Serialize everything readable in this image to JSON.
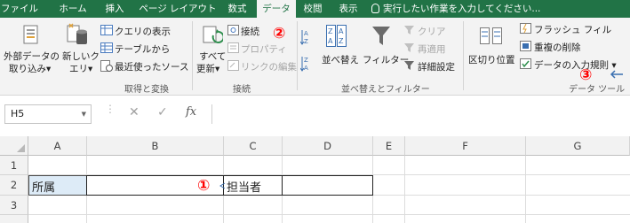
{
  "tabs": [
    {
      "label": "ファイル",
      "active": false
    },
    {
      "label": "ホーム",
      "active": false
    },
    {
      "label": "挿入",
      "active": false
    },
    {
      "label": "ページ レイアウト",
      "active": false
    },
    {
      "label": "数式",
      "active": false
    },
    {
      "label": "データ",
      "active": true
    },
    {
      "label": "校閲",
      "active": false
    },
    {
      "label": "表示",
      "active": false
    }
  ],
  "tell_me": "実行したい作業を入力してください...",
  "groups": {
    "get_transform": {
      "label": "取得と変換",
      "external_data": [
        "外部データの",
        "取り込み▾"
      ],
      "new_query": [
        "新しいク",
        "エリ▾"
      ],
      "show_queries": "クエリの表示",
      "from_table": "テーブルから",
      "recent_sources": "最近使ったソース"
    },
    "connections": {
      "label": "接続",
      "refresh_all": [
        "すべて",
        "更新▾"
      ],
      "connections_btn": "接続",
      "properties": "プロパティ",
      "edit_links": "リンクの編集"
    },
    "sort_filter": {
      "label": "並べ替えとフィルター",
      "sort_btn": "並べ替え",
      "filter_btn": "フィルター",
      "clear": "クリア",
      "reapply": "再適用",
      "advanced": "詳細設定"
    },
    "data_tools": {
      "label": "データ ツール",
      "text_to_columns": "区切り位置",
      "flash_fill": "フラッシュ フィル",
      "remove_duplicates": "重複の削除",
      "data_validation": "データの入力規則 ▾"
    }
  },
  "formula_bar": {
    "name_box": "H5",
    "cancel": "✕",
    "enter": "✓",
    "fx": "fx",
    "formula": ""
  },
  "sheet": {
    "columns": [
      "A",
      "B",
      "C",
      "D",
      "E",
      "F",
      "G"
    ],
    "rows": [
      "1",
      "2",
      "3"
    ],
    "cells": {
      "A2": "所属",
      "C2": "担当者"
    }
  },
  "annotations": {
    "m1": "①",
    "m2": "②",
    "m3": "③"
  },
  "colors": {
    "ribbon_green": "#217346",
    "selected_cell_fill": "#ddebf7",
    "annotation_red": "#ff0000"
  }
}
